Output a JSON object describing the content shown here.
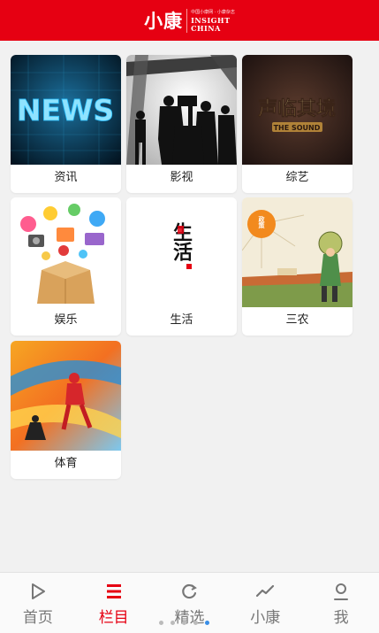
{
  "header": {
    "logo_main": "小康",
    "logo_tag": "中国小康网 · 小康杂志",
    "logo_en_line1": "INSIGHT",
    "logo_en_line2": "CHINA"
  },
  "categories": [
    {
      "label": "资讯",
      "image_text": "NEWS"
    },
    {
      "label": "影视"
    },
    {
      "label": "综艺",
      "image_text": "声临其境",
      "image_subtext": "THE SOUND"
    },
    {
      "label": "娱乐"
    },
    {
      "label": "生活",
      "image_text": "生活"
    },
    {
      "label": "三农",
      "image_text": "政策"
    },
    {
      "label": "体育"
    }
  ],
  "tabbar": {
    "items": [
      {
        "label": "首页",
        "icon": "play-icon",
        "active": false
      },
      {
        "label": "栏目",
        "icon": "menu-icon",
        "active": true
      },
      {
        "label": "精选",
        "icon": "refresh-icon",
        "active": false
      },
      {
        "label": "小康",
        "icon": "trend-icon",
        "active": false
      },
      {
        "label": "我",
        "icon": "user-icon",
        "active": false
      }
    ],
    "page_dots": 5,
    "active_dot": 4
  },
  "colors": {
    "brand_red": "#e60012",
    "background": "#f1f1f1",
    "active_dot": "#3a8ee6"
  }
}
